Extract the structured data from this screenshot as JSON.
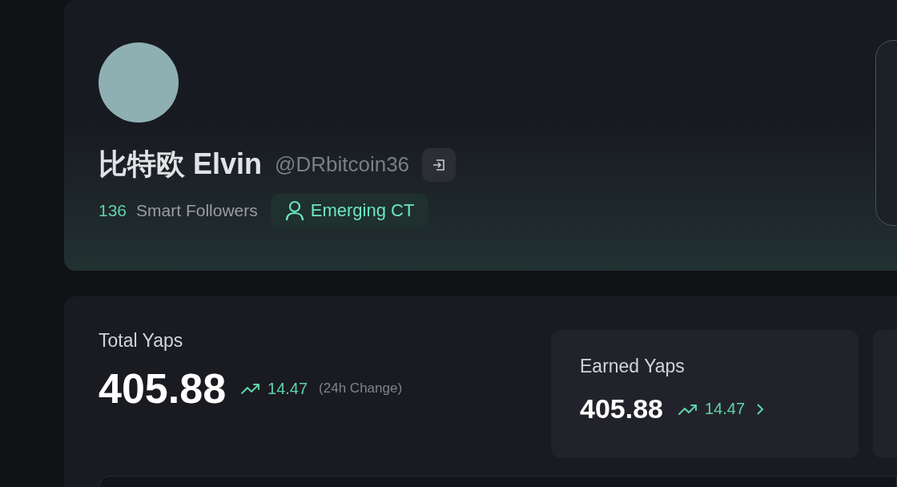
{
  "profile": {
    "display_name": "比特欧 Elvin",
    "handle": "@DRbitcoin36",
    "smart_followers": {
      "count": "136",
      "label": "Smart Followers"
    },
    "tag": "Emerging CT"
  },
  "stats": {
    "total": {
      "label": "Total Yaps",
      "value": "405.88",
      "change": "14.47",
      "change_note": "(24h Change)"
    },
    "cards": [
      {
        "label": "Earned Yaps",
        "value": "405.88",
        "change": "14.47"
      }
    ]
  }
}
